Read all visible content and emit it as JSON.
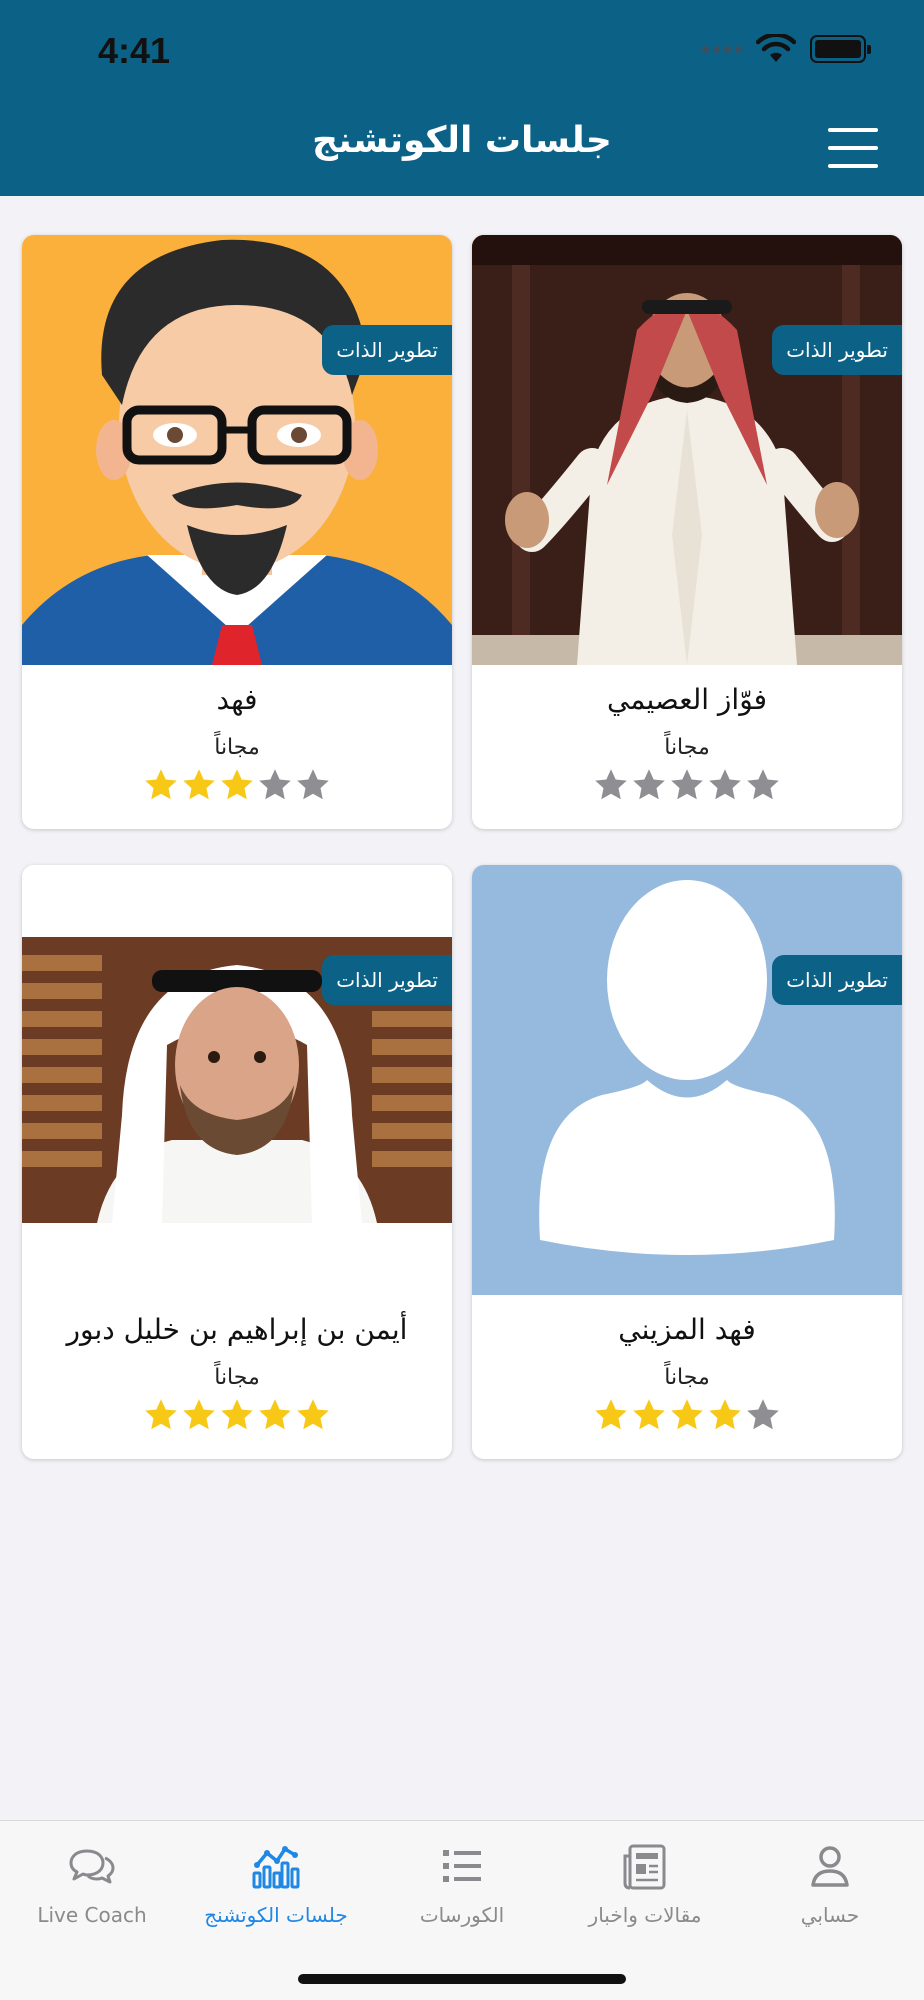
{
  "status_bar": {
    "time": "4:41"
  },
  "header": {
    "title": "جلسات الكوتشنج"
  },
  "coaches": [
    {
      "name": "فوّاز العصيمي",
      "category": "تطوير الذات",
      "price": "مجاناً",
      "rating": 0
    },
    {
      "name": "فهد",
      "category": "تطوير الذات",
      "price": "مجاناً",
      "rating": 3
    },
    {
      "name": "فهد المزيني",
      "category": "تطوير الذات",
      "price": "مجاناً",
      "rating": 4
    },
    {
      "name": "أيمن بن إبراهيم بن خليل دبور",
      "category": "تطوير الذات",
      "price": "مجاناً",
      "rating": 5
    }
  ],
  "tabbar": {
    "items": [
      {
        "label": "حسابي",
        "icon": "person-icon"
      },
      {
        "label": "مقالات واخبار",
        "icon": "newspaper-icon"
      },
      {
        "label": "الكورسات",
        "icon": "list-icon"
      },
      {
        "label": "جلسات الكوتشنج",
        "icon": "chart-icon",
        "active": true
      },
      {
        "label": "Live Coach",
        "icon": "chat-bubbles-icon"
      }
    ]
  },
  "colors": {
    "header": "#0c6286",
    "active_tab": "#1f87e6",
    "star_on": "#f8c817",
    "star_off": "#8e8e93"
  }
}
